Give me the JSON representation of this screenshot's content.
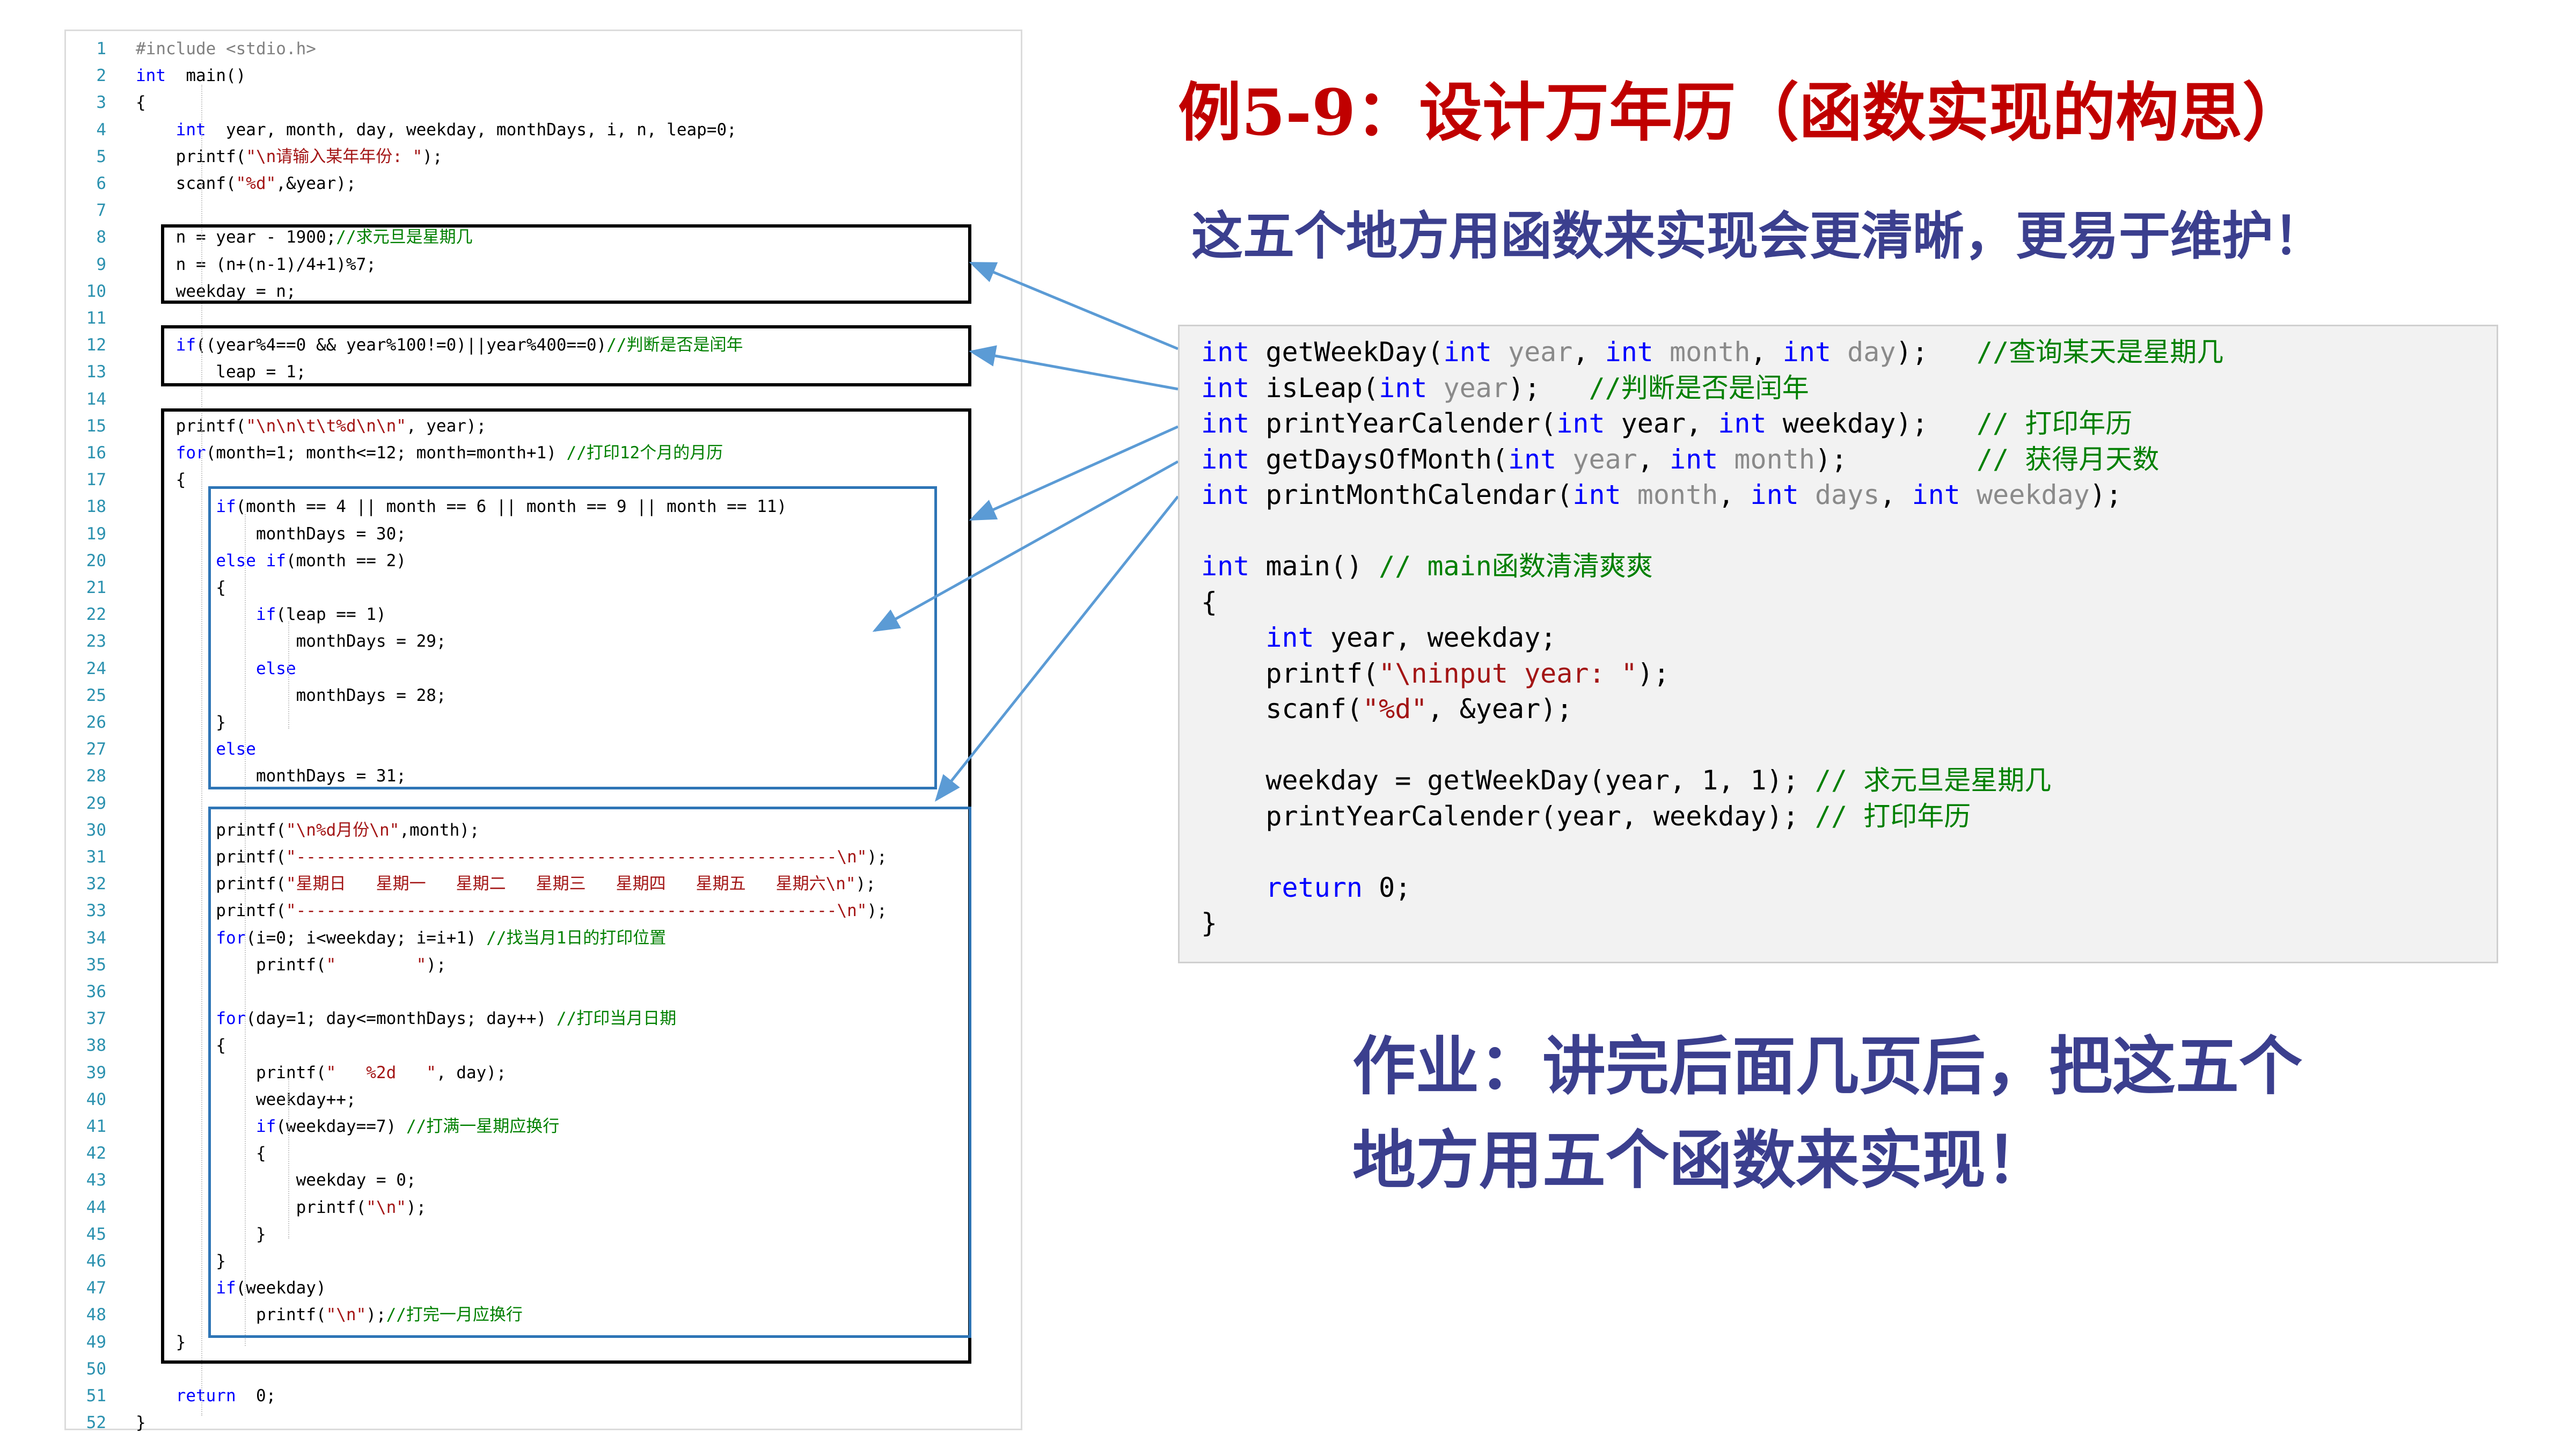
{
  "title": "例5-9：设计万年历（函数实现的构思）",
  "subtitle": "这五个地方用函数来实现会更清晰，更易于维护！",
  "homework": [
    "作业：讲完后面几页后，把这五个",
    "地方用五个函数来实现！"
  ],
  "left_code": {
    "line_numbers": [
      "1",
      "2",
      "3",
      "4",
      "5",
      "6",
      "7",
      "8",
      "9",
      "10",
      "11",
      "12",
      "13",
      "14",
      "15",
      "16",
      "17",
      "18",
      "19",
      "20",
      "21",
      "22",
      "23",
      "24",
      "25",
      "26",
      "27",
      "28",
      "29",
      "30",
      "31",
      "32",
      "33",
      "34",
      "35",
      "36",
      "37",
      "38",
      "39",
      "40",
      "41",
      "42",
      "43",
      "44",
      "45",
      "46",
      "47",
      "48",
      "49",
      "50",
      "51",
      "52"
    ],
    "lines": [
      [
        [
          "pp",
          "#include <stdio.h>"
        ]
      ],
      [
        [
          "kw",
          "int"
        ],
        [
          "",
          "  main()"
        ]
      ],
      [
        [
          "",
          "{"
        ]
      ],
      [
        [
          "",
          "    "
        ],
        [
          "kw",
          "int"
        ],
        [
          "",
          "  year, month, day, weekday, monthDays, i, n, leap=0;"
        ]
      ],
      [
        [
          "",
          "    printf("
        ],
        [
          "str",
          "\"\\n请输入某年年份: \""
        ],
        [
          "",
          ");"
        ]
      ],
      [
        [
          "",
          "    scanf("
        ],
        [
          "str",
          "\"%d\""
        ],
        [
          "",
          ",&year);"
        ]
      ],
      [
        [
          "",
          ""
        ]
      ],
      [
        [
          "",
          "    n = year - 1900;"
        ],
        [
          "cm",
          "//求元旦是星期几"
        ]
      ],
      [
        [
          "",
          "    n = (n+(n-1)/4+1)%7;"
        ]
      ],
      [
        [
          "",
          "    weekday = n;"
        ]
      ],
      [
        [
          "",
          ""
        ]
      ],
      [
        [
          "",
          "    "
        ],
        [
          "kw",
          "if"
        ],
        [
          "",
          "((year%4==0 && year%100!=0)||year%400==0)"
        ],
        [
          "cm",
          "//判断是否是闰年"
        ]
      ],
      [
        [
          "",
          "        leap = 1;"
        ]
      ],
      [
        [
          "",
          ""
        ]
      ],
      [
        [
          "",
          "    printf("
        ],
        [
          "str",
          "\"\\n\\n\\t\\t%d\\n\\n\""
        ],
        [
          "",
          ", year);"
        ]
      ],
      [
        [
          "",
          "    "
        ],
        [
          "kw",
          "for"
        ],
        [
          "",
          "(month=1; month<=12; month=month+1) "
        ],
        [
          "cm",
          "//打印12个月的月历"
        ]
      ],
      [
        [
          "",
          "    {"
        ]
      ],
      [
        [
          "",
          "        "
        ],
        [
          "kw",
          "if"
        ],
        [
          "",
          "(month == 4 || month == 6 || month == 9 || month == 11)"
        ]
      ],
      [
        [
          "",
          "            monthDays = 30;"
        ]
      ],
      [
        [
          "",
          "        "
        ],
        [
          "kw",
          "else if"
        ],
        [
          "",
          "(month == 2)"
        ]
      ],
      [
        [
          "",
          "        {"
        ]
      ],
      [
        [
          "",
          "            "
        ],
        [
          "kw",
          "if"
        ],
        [
          "",
          "(leap == 1)"
        ]
      ],
      [
        [
          "",
          "                monthDays = 29;"
        ]
      ],
      [
        [
          "",
          "            "
        ],
        [
          "kw",
          "else"
        ]
      ],
      [
        [
          "",
          "                monthDays = 28;"
        ]
      ],
      [
        [
          "",
          "        }"
        ]
      ],
      [
        [
          "",
          "        "
        ],
        [
          "kw",
          "else"
        ]
      ],
      [
        [
          "",
          "            monthDays = 31;"
        ]
      ],
      [
        [
          "",
          ""
        ]
      ],
      [
        [
          "",
          "        printf("
        ],
        [
          "str",
          "\"\\n%d月份\\n\""
        ],
        [
          "",
          ",month);"
        ]
      ],
      [
        [
          "",
          "        printf("
        ],
        [
          "str",
          "\"------------------------------------------------------\\n\""
        ],
        [
          "",
          ");"
        ]
      ],
      [
        [
          "",
          "        printf("
        ],
        [
          "str",
          "\"星期日   星期一   星期二   星期三   星期四   星期五   星期六\\n\""
        ],
        [
          "",
          ");"
        ]
      ],
      [
        [
          "",
          "        printf("
        ],
        [
          "str",
          "\"------------------------------------------------------\\n\""
        ],
        [
          "",
          ");"
        ]
      ],
      [
        [
          "",
          "        "
        ],
        [
          "kw",
          "for"
        ],
        [
          "",
          "(i=0; i<weekday; i=i+1) "
        ],
        [
          "cm",
          "//找当月1日的打印位置"
        ]
      ],
      [
        [
          "",
          "            printf("
        ],
        [
          "str",
          "\"        \""
        ],
        [
          "",
          ");"
        ]
      ],
      [
        [
          "",
          ""
        ]
      ],
      [
        [
          "",
          "        "
        ],
        [
          "kw",
          "for"
        ],
        [
          "",
          "(day=1; day<=monthDays; day++) "
        ],
        [
          "cm",
          "//打印当月日期"
        ]
      ],
      [
        [
          "",
          "        {"
        ]
      ],
      [
        [
          "",
          "            printf("
        ],
        [
          "str",
          "\"   %2d   \""
        ],
        [
          "",
          ", day);"
        ]
      ],
      [
        [
          "",
          "            weekday++;"
        ]
      ],
      [
        [
          "",
          "            "
        ],
        [
          "kw",
          "if"
        ],
        [
          "",
          "(weekday==7) "
        ],
        [
          "cm",
          "//打满一星期应换行"
        ]
      ],
      [
        [
          "",
          "            {"
        ]
      ],
      [
        [
          "",
          "                weekday = 0;"
        ]
      ],
      [
        [
          "",
          "                printf("
        ],
        [
          "str",
          "\"\\n\""
        ],
        [
          "",
          ");"
        ]
      ],
      [
        [
          "",
          "            }"
        ]
      ],
      [
        [
          "",
          "        }"
        ]
      ],
      [
        [
          "",
          "        "
        ],
        [
          "kw",
          "if"
        ],
        [
          "",
          "(weekday)"
        ]
      ],
      [
        [
          "",
          "            printf("
        ],
        [
          "str",
          "\"\\n\""
        ],
        [
          "",
          ");"
        ],
        [
          "cm",
          "//打完一月应换行"
        ]
      ],
      [
        [
          "",
          "    }"
        ]
      ],
      [
        [
          "",
          ""
        ]
      ],
      [
        [
          "",
          "    "
        ],
        [
          "kw",
          "return"
        ],
        [
          "",
          "  0;"
        ]
      ],
      [
        [
          "",
          "}"
        ]
      ]
    ]
  },
  "right_code": [
    [
      [
        "rkw",
        "int"
      ],
      [
        "",
        " getWeekDay("
      ],
      [
        "rkw",
        "int"
      ],
      [
        "rparam",
        " year"
      ],
      [
        "",
        ", "
      ],
      [
        "rkw",
        "int"
      ],
      [
        "rparam",
        " month"
      ],
      [
        "",
        ", "
      ],
      [
        "rkw",
        "int"
      ],
      [
        "rparam",
        " day"
      ],
      [
        "",
        ");   "
      ],
      [
        "rcm",
        "//查询某天是星期几"
      ]
    ],
    [
      [
        "rkw",
        "int"
      ],
      [
        "",
        " isLeap("
      ],
      [
        "rkw",
        "int"
      ],
      [
        "rparam",
        " year"
      ],
      [
        "",
        ");   "
      ],
      [
        "rcm",
        "//判断是否是闰年"
      ]
    ],
    [
      [
        "rkw",
        "int"
      ],
      [
        "",
        " printYearCalender("
      ],
      [
        "rkw",
        "int"
      ],
      [
        "",
        " year, "
      ],
      [
        "rkw",
        "int"
      ],
      [
        "",
        " weekday);   "
      ],
      [
        "rcm",
        "// 打印年历"
      ]
    ],
    [
      [
        "rkw",
        "int"
      ],
      [
        "",
        " getDaysOfMonth("
      ],
      [
        "rkw",
        "int"
      ],
      [
        "rparam",
        " year"
      ],
      [
        "",
        ", "
      ],
      [
        "rkw",
        "int"
      ],
      [
        "rparam",
        " month"
      ],
      [
        "",
        ");        "
      ],
      [
        "rcm",
        "// 获得月天数"
      ]
    ],
    [
      [
        "rkw",
        "int"
      ],
      [
        "",
        " printMonthCalendar("
      ],
      [
        "rkw",
        "int"
      ],
      [
        "rparam",
        " month"
      ],
      [
        "",
        ", "
      ],
      [
        "rkw",
        "int"
      ],
      [
        "rparam",
        " days"
      ],
      [
        "",
        ", "
      ],
      [
        "rkw",
        "int"
      ],
      [
        "rparam",
        " weekday"
      ],
      [
        "",
        ");"
      ]
    ],
    [
      [
        "",
        ""
      ]
    ],
    [
      [
        "rkw",
        "int"
      ],
      [
        "",
        " main() "
      ],
      [
        "rcm",
        "// main函数清清爽爽"
      ]
    ],
    [
      [
        "",
        "{"
      ]
    ],
    [
      [
        "",
        "    "
      ],
      [
        "rkw",
        "int"
      ],
      [
        "",
        " year, weekday;"
      ]
    ],
    [
      [
        "",
        "    printf("
      ],
      [
        "rstr",
        "\"\\ninput year: \""
      ],
      [
        "",
        ");"
      ]
    ],
    [
      [
        "",
        "    scanf("
      ],
      [
        "rstr",
        "\"%d\""
      ],
      [
        "",
        ", &year);"
      ]
    ],
    [
      [
        "",
        ""
      ]
    ],
    [
      [
        "",
        "    weekday = getWeekDay(year, 1, 1); "
      ],
      [
        "rcm",
        "// 求元旦是星期几"
      ]
    ],
    [
      [
        "",
        "    printYearCalender(year, weekday); "
      ],
      [
        "rcm",
        "// 打印年历"
      ]
    ],
    [
      [
        "",
        ""
      ]
    ],
    [
      [
        "",
        "    "
      ],
      [
        "rkw",
        "return"
      ],
      [
        "",
        " 0;"
      ]
    ],
    [
      [
        "",
        "}"
      ]
    ]
  ],
  "colors": {
    "title": "#c00000",
    "subtitle": "#3b3f8e",
    "keyword": "#0000ff",
    "string": "#a31515",
    "comment": "#008000",
    "line_number": "#2b91af",
    "highlight_box_blue": "#2e75b6",
    "arrow": "#5b9bd5"
  }
}
